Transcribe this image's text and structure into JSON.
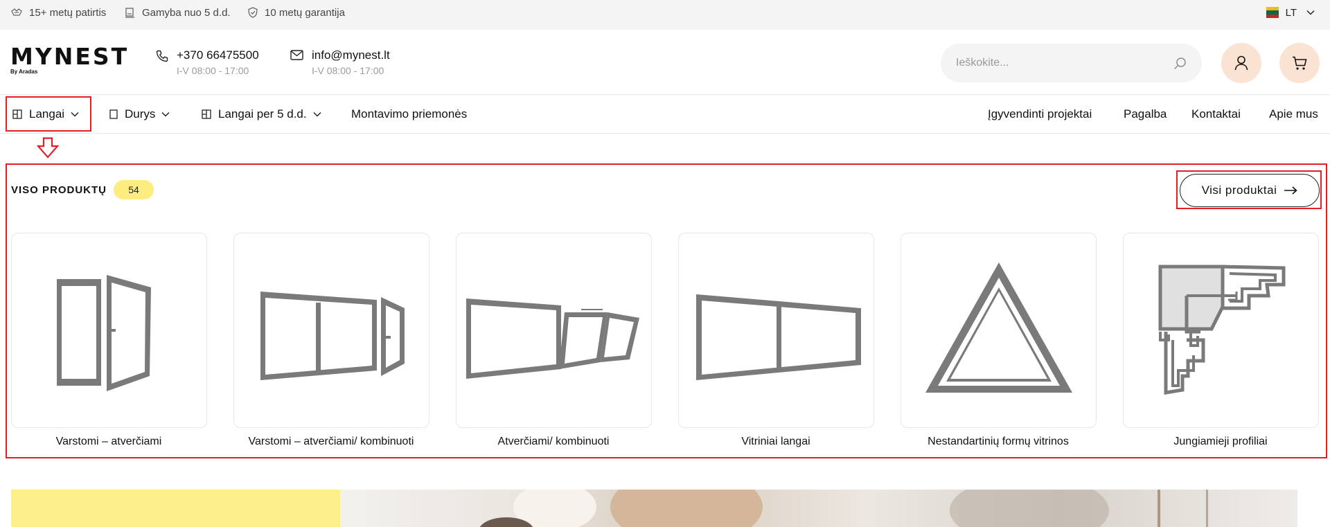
{
  "topbar": {
    "features": [
      {
        "icon": "medal-icon",
        "label": "15+ metų patirtis"
      },
      {
        "icon": "factory-icon",
        "label": "Gamyba nuo 5 d.d."
      },
      {
        "icon": "shield-check-icon",
        "label": "10 metų garantija"
      }
    ],
    "language": "LT"
  },
  "header": {
    "logo_text": "MYNEST",
    "logo_sub": "By Aradas",
    "phone": "+370 66475500",
    "phone_hours": "I-V 08:00 - 17:00",
    "email": "info@mynest.lt",
    "email_hours": "I-V 08:00 - 17:00",
    "search_placeholder": "Ieškokite..."
  },
  "nav": {
    "left": [
      {
        "label": "Langai",
        "icon": "window-icon",
        "dropdown": true
      },
      {
        "label": "Durys",
        "icon": "door-icon",
        "dropdown": true
      },
      {
        "label": "Langai per 5 d.d.",
        "icon": "window-icon",
        "dropdown": true
      },
      {
        "label": "Montavimo priemonės",
        "dropdown": false
      }
    ],
    "right": [
      "Įgyvendinti projektai",
      "Pagalba",
      "Kontaktai",
      "Apie mus"
    ]
  },
  "products": {
    "title": "VISO PRODUKTŲ",
    "count": "54",
    "all_button": "Visi produktai",
    "categories": [
      {
        "label": "Varstomi – atverčiami",
        "icon": "casement-window-icon"
      },
      {
        "label": "Varstomi – atverčiami/ kombinuoti",
        "icon": "combined-window-icon"
      },
      {
        "label": "Atverčiami/ kombinuoti",
        "icon": "tilt-window-icon"
      },
      {
        "label": "Vitriniai langai",
        "icon": "display-window-icon"
      },
      {
        "label": "Nestandartinių formų vitrinos",
        "icon": "triangle-window-icon"
      },
      {
        "label": "Jungiamieji profiliai",
        "icon": "profile-section-icon"
      }
    ]
  },
  "colors": {
    "highlight": "#e31e25",
    "badge": "#fdec7f",
    "icon_button_bg": "#fbe3d4",
    "product_grey": "#7a7a7a",
    "banner_yellow": "#fdf08a"
  }
}
